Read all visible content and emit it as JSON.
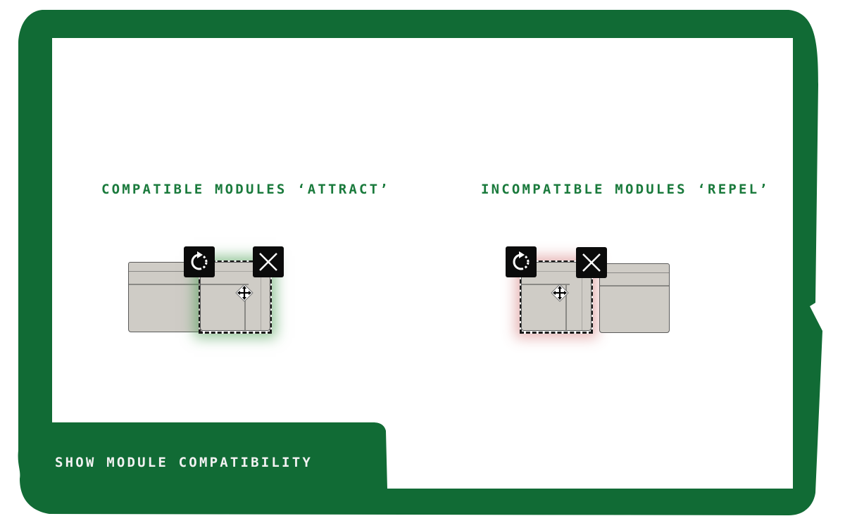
{
  "theme": {
    "frame_color": "#116b35",
    "caption_color": "#1a7a3c",
    "module_fill": "#cfccc6",
    "compatible_glow": "#3c9646",
    "incompatible_glow": "#c85a5a"
  },
  "examples": [
    {
      "caption": "COMPATIBLE MODULES ‘ATTRACT’",
      "state": "compatible",
      "controls": [
        "rotate-icon",
        "close-icon",
        "move-icon"
      ]
    },
    {
      "caption": "INCOMPATIBLE MODULES ‘REPEL’",
      "state": "incompatible",
      "controls": [
        "rotate-icon",
        "close-icon",
        "move-icon"
      ]
    }
  ],
  "action": {
    "label": "SHOW MODULE COMPATIBILITY"
  }
}
